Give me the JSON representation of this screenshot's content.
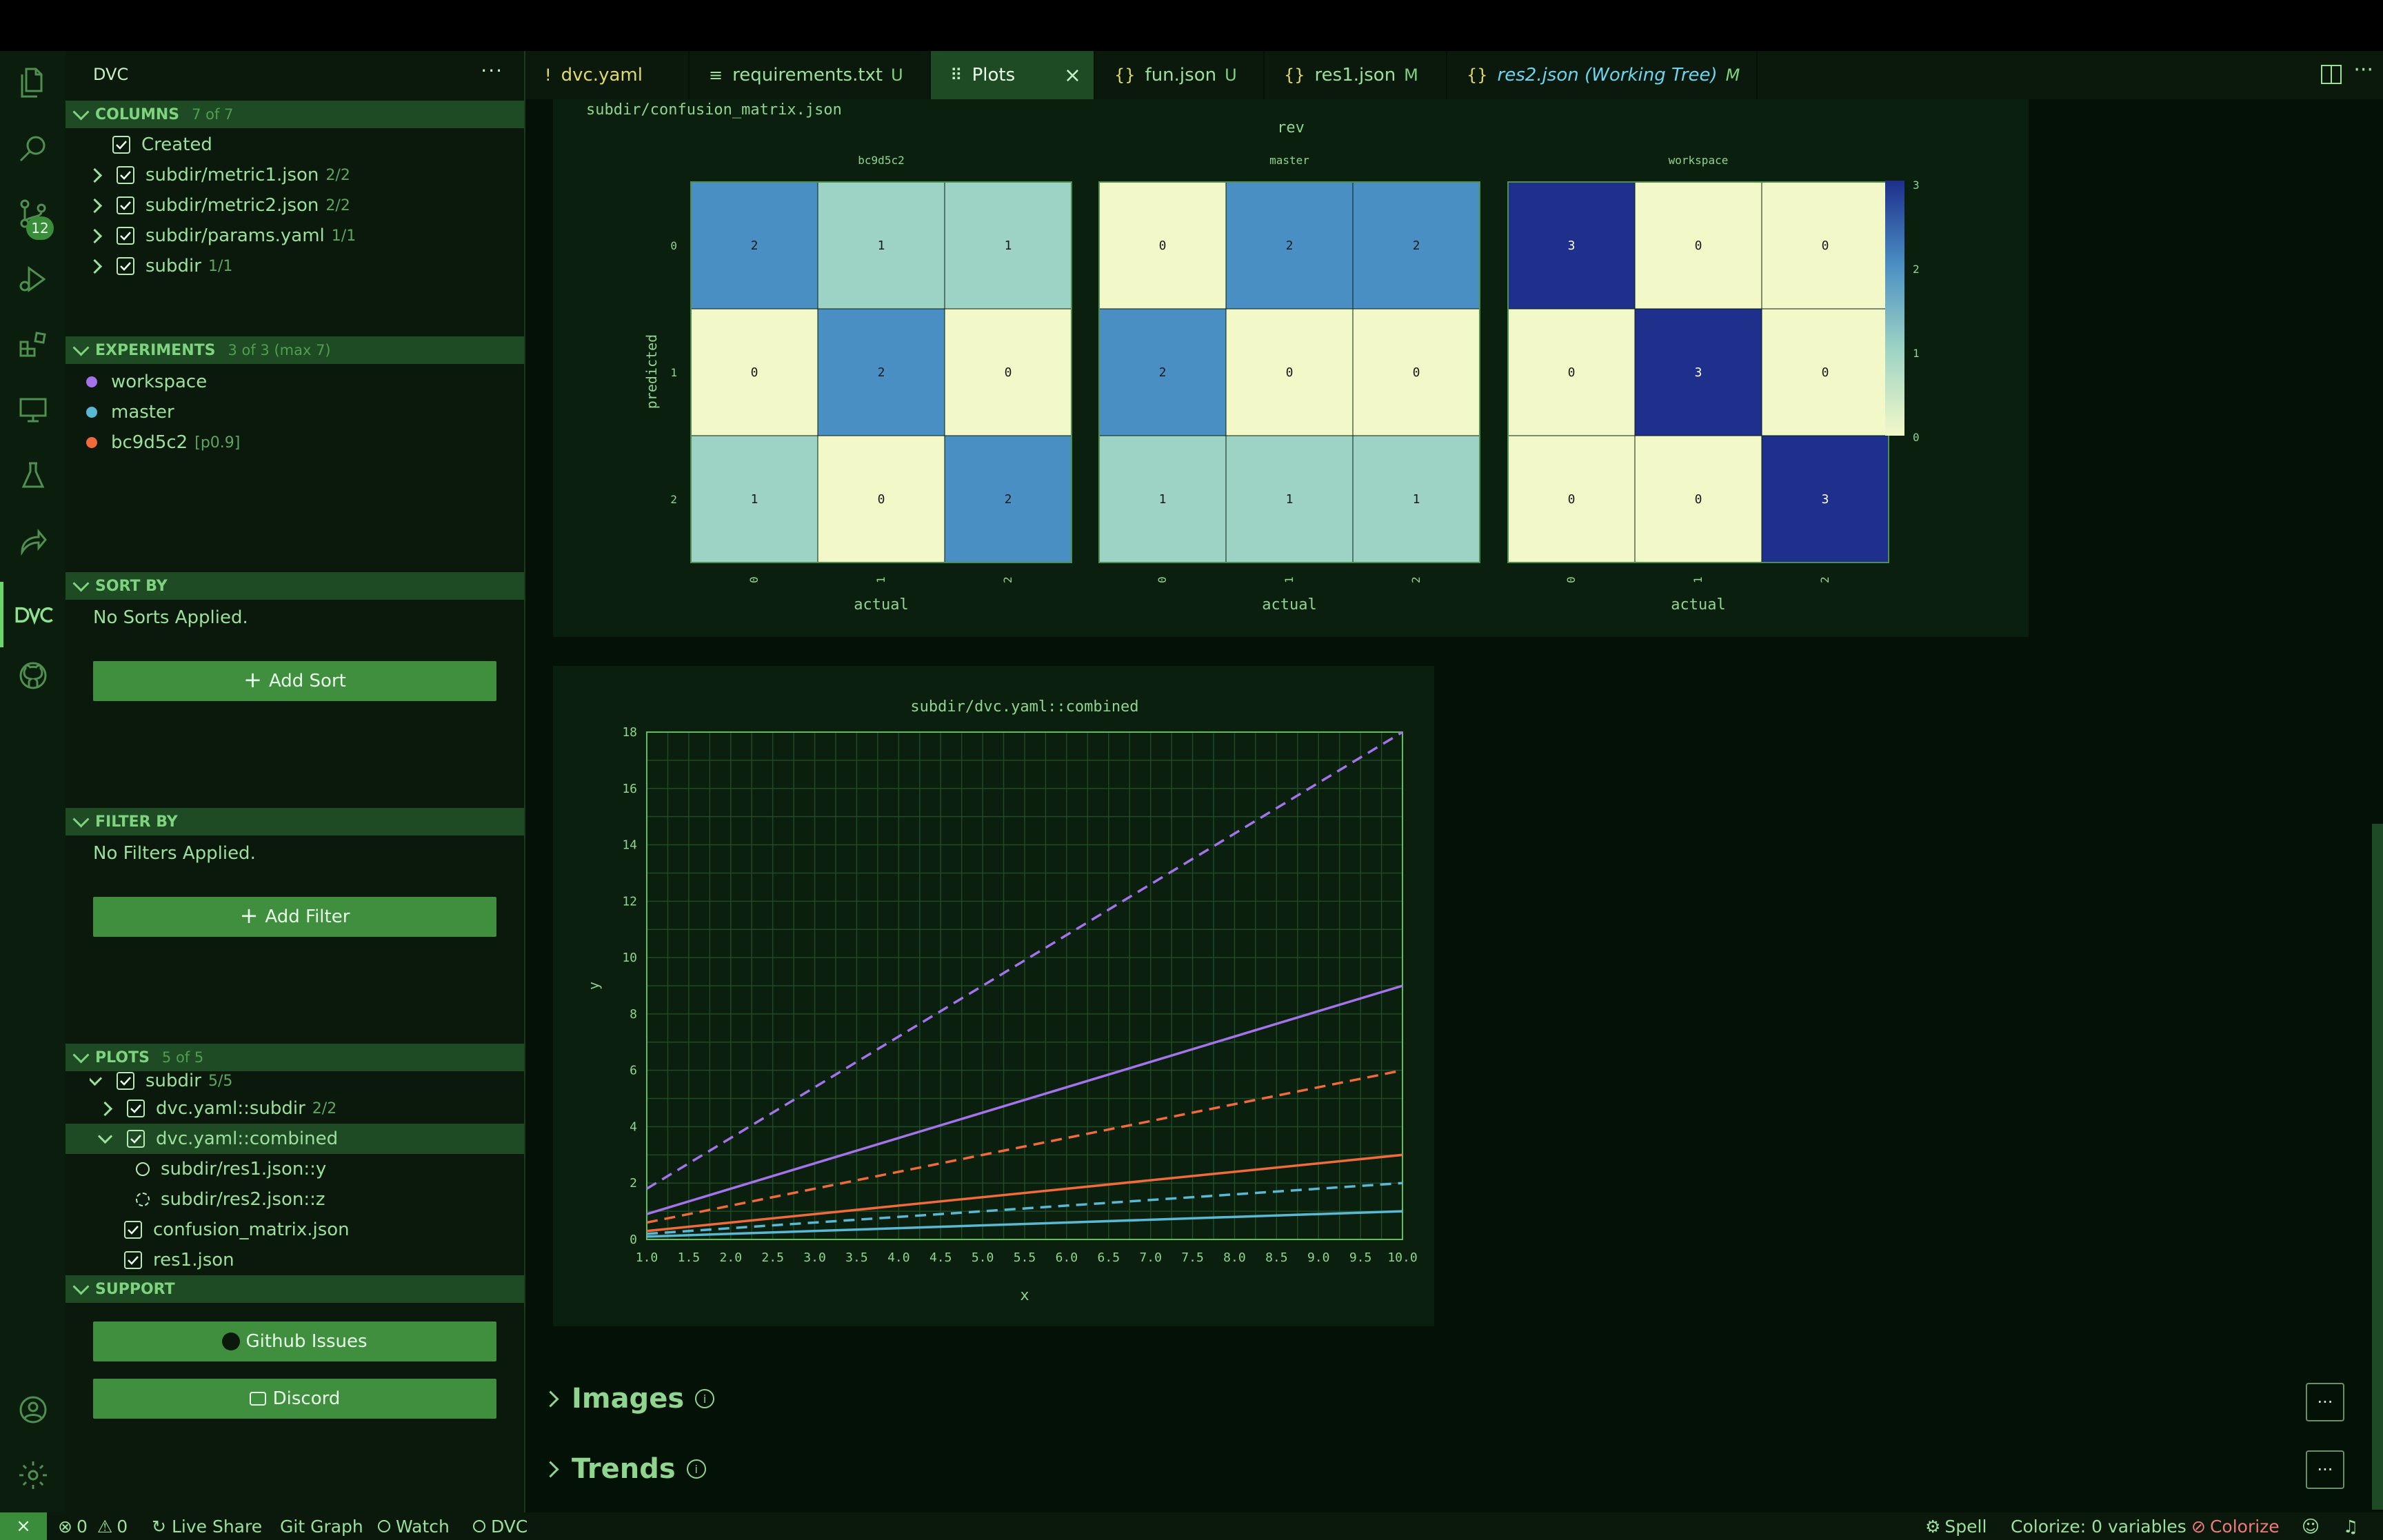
{
  "sidebar": {
    "title": "DVC",
    "more": "···",
    "scm_badge": "12",
    "columns": {
      "header": "COLUMNS",
      "count": "7 of 7",
      "items": [
        {
          "label": "Created",
          "sub": ""
        },
        {
          "label": "subdir/metric1.json",
          "sub": "2/2"
        },
        {
          "label": "subdir/metric2.json",
          "sub": "2/2"
        },
        {
          "label": "subdir/params.yaml",
          "sub": "1/1"
        },
        {
          "label": "subdir",
          "sub": "1/1"
        }
      ]
    },
    "experiments": {
      "header": "EXPERIMENTS",
      "count": "3 of 3 (max 7)",
      "items": [
        {
          "label": "workspace",
          "sub": "",
          "color": "#a473ea"
        },
        {
          "label": "master",
          "sub": "",
          "color": "#5ab8d4"
        },
        {
          "label": "bc9d5c2",
          "sub": "[p0.9]",
          "color": "#f06a3c"
        }
      ]
    },
    "sort": {
      "header": "SORT BY",
      "empty": "No Sorts Applied.",
      "button": "Add Sort"
    },
    "filter": {
      "header": "FILTER BY",
      "empty": "No Filters Applied.",
      "button": "Add Filter"
    },
    "plots": {
      "header": "PLOTS",
      "count": "5 of 5",
      "items": [
        {
          "label": "subdir",
          "sub": "5/5"
        },
        {
          "label": "dvc.yaml::subdir",
          "sub": "2/2"
        },
        {
          "label": "dvc.yaml::combined",
          "sub": ""
        },
        {
          "label": "subdir/res1.json::y",
          "sub": ""
        },
        {
          "label": "subdir/res2.json::z",
          "sub": ""
        },
        {
          "label": "confusion_matrix.json",
          "sub": ""
        },
        {
          "label": "res1.json",
          "sub": ""
        }
      ]
    },
    "support": {
      "header": "SUPPORT",
      "github": "Github Issues",
      "discord": "Discord"
    }
  },
  "tabs": [
    {
      "label": "dvc.yaml",
      "icon": "!",
      "status": ""
    },
    {
      "label": "requirements.txt",
      "icon": "≡",
      "status": "U"
    },
    {
      "label": "Plots",
      "icon": "⠿",
      "status": ""
    },
    {
      "label": "fun.json",
      "icon": "{}",
      "status": "U"
    },
    {
      "label": "res1.json",
      "icon": "{}",
      "status": "M"
    },
    {
      "label": "res2.json (Working Tree)",
      "icon": "{}",
      "status": "M"
    }
  ],
  "confusion": {
    "file": "subdir/confusion_matrix.json",
    "facet_title": "rev",
    "panels": [
      {
        "rev": "bc9d5c2",
        "cells": [
          [
            2,
            1,
            1
          ],
          [
            0,
            2,
            0
          ],
          [
            1,
            0,
            2
          ]
        ]
      },
      {
        "rev": "master",
        "cells": [
          [
            0,
            2,
            2
          ],
          [
            2,
            0,
            0
          ],
          [
            1,
            1,
            1
          ]
        ]
      },
      {
        "rev": "workspace",
        "cells": [
          [
            3,
            0,
            0
          ],
          [
            0,
            3,
            0
          ],
          [
            0,
            0,
            3
          ]
        ]
      }
    ],
    "ylabel": "predicted",
    "xlabel": "actual",
    "ticks": [
      "0",
      "1",
      "2"
    ],
    "legend_ticks": [
      "3",
      "2",
      "1",
      "0"
    ]
  },
  "chart_data": {
    "type": "line",
    "title": "subdir/dvc.yaml::combined",
    "xlabel": "x",
    "ylabel": "y",
    "xlim": [
      1.0,
      10.0
    ],
    "ylim": [
      0,
      18
    ],
    "x_ticks": [
      "1.0",
      "1.5",
      "2.0",
      "2.5",
      "3.0",
      "3.5",
      "4.0",
      "4.5",
      "5.0",
      "5.5",
      "6.0",
      "6.5",
      "7.0",
      "7.5",
      "8.0",
      "8.5",
      "9.0",
      "9.5",
      "10.0"
    ],
    "y_ticks": [
      "0",
      "2",
      "4",
      "6",
      "8",
      "10",
      "12",
      "14",
      "16",
      "18"
    ],
    "grid": true,
    "series": [
      {
        "color": "#a473ea",
        "dash": true,
        "x": [
          1,
          10
        ],
        "y": [
          1.8,
          18
        ]
      },
      {
        "color": "#a473ea",
        "dash": false,
        "x": [
          1,
          10
        ],
        "y": [
          0.9,
          9
        ]
      },
      {
        "color": "#f06a3c",
        "dash": true,
        "x": [
          1,
          10
        ],
        "y": [
          0.6,
          6
        ]
      },
      {
        "color": "#f06a3c",
        "dash": false,
        "x": [
          1,
          10
        ],
        "y": [
          0.3,
          3
        ]
      },
      {
        "color": "#5ab8d4",
        "dash": true,
        "x": [
          1,
          10
        ],
        "y": [
          0.2,
          2
        ]
      },
      {
        "color": "#5ab8d4",
        "dash": false,
        "x": [
          1,
          10
        ],
        "y": [
          0.1,
          1
        ]
      }
    ]
  },
  "sections": [
    {
      "label": "Images",
      "info": "i",
      "more": "···"
    },
    {
      "label": "Trends",
      "info": "i",
      "more": "···"
    }
  ],
  "status": {
    "remote": "⨯",
    "errors": "0",
    "warnings": "0",
    "live_share": "Live Share",
    "git_graph": "Git Graph",
    "watch": "Watch",
    "dvc": "DVC",
    "spell": "Spell",
    "colorize_vars": "Colorize: 0 variables",
    "colorize": "Colorize"
  }
}
